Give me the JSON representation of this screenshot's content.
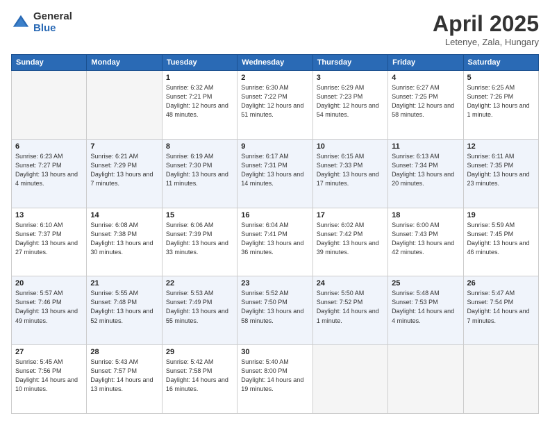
{
  "logo": {
    "general": "General",
    "blue": "Blue"
  },
  "header": {
    "title": "April 2025",
    "subtitle": "Letenye, Zala, Hungary"
  },
  "days_of_week": [
    "Sunday",
    "Monday",
    "Tuesday",
    "Wednesday",
    "Thursday",
    "Friday",
    "Saturday"
  ],
  "weeks": [
    [
      {
        "day": "",
        "info": ""
      },
      {
        "day": "",
        "info": ""
      },
      {
        "day": "1",
        "info": "Sunrise: 6:32 AM\nSunset: 7:21 PM\nDaylight: 12 hours and 48 minutes."
      },
      {
        "day": "2",
        "info": "Sunrise: 6:30 AM\nSunset: 7:22 PM\nDaylight: 12 hours and 51 minutes."
      },
      {
        "day": "3",
        "info": "Sunrise: 6:29 AM\nSunset: 7:23 PM\nDaylight: 12 hours and 54 minutes."
      },
      {
        "day": "4",
        "info": "Sunrise: 6:27 AM\nSunset: 7:25 PM\nDaylight: 12 hours and 58 minutes."
      },
      {
        "day": "5",
        "info": "Sunrise: 6:25 AM\nSunset: 7:26 PM\nDaylight: 13 hours and 1 minute."
      }
    ],
    [
      {
        "day": "6",
        "info": "Sunrise: 6:23 AM\nSunset: 7:27 PM\nDaylight: 13 hours and 4 minutes."
      },
      {
        "day": "7",
        "info": "Sunrise: 6:21 AM\nSunset: 7:29 PM\nDaylight: 13 hours and 7 minutes."
      },
      {
        "day": "8",
        "info": "Sunrise: 6:19 AM\nSunset: 7:30 PM\nDaylight: 13 hours and 11 minutes."
      },
      {
        "day": "9",
        "info": "Sunrise: 6:17 AM\nSunset: 7:31 PM\nDaylight: 13 hours and 14 minutes."
      },
      {
        "day": "10",
        "info": "Sunrise: 6:15 AM\nSunset: 7:33 PM\nDaylight: 13 hours and 17 minutes."
      },
      {
        "day": "11",
        "info": "Sunrise: 6:13 AM\nSunset: 7:34 PM\nDaylight: 13 hours and 20 minutes."
      },
      {
        "day": "12",
        "info": "Sunrise: 6:11 AM\nSunset: 7:35 PM\nDaylight: 13 hours and 23 minutes."
      }
    ],
    [
      {
        "day": "13",
        "info": "Sunrise: 6:10 AM\nSunset: 7:37 PM\nDaylight: 13 hours and 27 minutes."
      },
      {
        "day": "14",
        "info": "Sunrise: 6:08 AM\nSunset: 7:38 PM\nDaylight: 13 hours and 30 minutes."
      },
      {
        "day": "15",
        "info": "Sunrise: 6:06 AM\nSunset: 7:39 PM\nDaylight: 13 hours and 33 minutes."
      },
      {
        "day": "16",
        "info": "Sunrise: 6:04 AM\nSunset: 7:41 PM\nDaylight: 13 hours and 36 minutes."
      },
      {
        "day": "17",
        "info": "Sunrise: 6:02 AM\nSunset: 7:42 PM\nDaylight: 13 hours and 39 minutes."
      },
      {
        "day": "18",
        "info": "Sunrise: 6:00 AM\nSunset: 7:43 PM\nDaylight: 13 hours and 42 minutes."
      },
      {
        "day": "19",
        "info": "Sunrise: 5:59 AM\nSunset: 7:45 PM\nDaylight: 13 hours and 46 minutes."
      }
    ],
    [
      {
        "day": "20",
        "info": "Sunrise: 5:57 AM\nSunset: 7:46 PM\nDaylight: 13 hours and 49 minutes."
      },
      {
        "day": "21",
        "info": "Sunrise: 5:55 AM\nSunset: 7:48 PM\nDaylight: 13 hours and 52 minutes."
      },
      {
        "day": "22",
        "info": "Sunrise: 5:53 AM\nSunset: 7:49 PM\nDaylight: 13 hours and 55 minutes."
      },
      {
        "day": "23",
        "info": "Sunrise: 5:52 AM\nSunset: 7:50 PM\nDaylight: 13 hours and 58 minutes."
      },
      {
        "day": "24",
        "info": "Sunrise: 5:50 AM\nSunset: 7:52 PM\nDaylight: 14 hours and 1 minute."
      },
      {
        "day": "25",
        "info": "Sunrise: 5:48 AM\nSunset: 7:53 PM\nDaylight: 14 hours and 4 minutes."
      },
      {
        "day": "26",
        "info": "Sunrise: 5:47 AM\nSunset: 7:54 PM\nDaylight: 14 hours and 7 minutes."
      }
    ],
    [
      {
        "day": "27",
        "info": "Sunrise: 5:45 AM\nSunset: 7:56 PM\nDaylight: 14 hours and 10 minutes."
      },
      {
        "day": "28",
        "info": "Sunrise: 5:43 AM\nSunset: 7:57 PM\nDaylight: 14 hours and 13 minutes."
      },
      {
        "day": "29",
        "info": "Sunrise: 5:42 AM\nSunset: 7:58 PM\nDaylight: 14 hours and 16 minutes."
      },
      {
        "day": "30",
        "info": "Sunrise: 5:40 AM\nSunset: 8:00 PM\nDaylight: 14 hours and 19 minutes."
      },
      {
        "day": "",
        "info": ""
      },
      {
        "day": "",
        "info": ""
      },
      {
        "day": "",
        "info": ""
      }
    ]
  ]
}
